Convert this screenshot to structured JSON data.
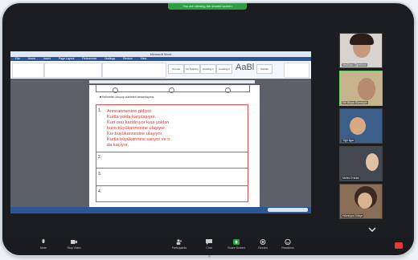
{
  "zoom_banner": "You are viewing the shared screen",
  "word": {
    "window_title": "Microsoft Word",
    "menu": [
      "File",
      "Home",
      "Insert",
      "Page Layout",
      "References",
      "Mailings",
      "Review",
      "View"
    ],
    "styles": [
      "Normal",
      "No Spacing",
      "Heading 1",
      "Heading 2",
      "Title",
      "Subtitle"
    ],
    "style_big": "AaBl",
    "bullet_text": "Kelimeleri okuyup cümleleri tamamlayınız.",
    "answers": [
      "Anneanmesine gidiyor.",
      "Kurtla yolda karşılaşıyor.",
      "Kurt onu kandırıyor kısa yoldan",
      "kızın büyükannesine ulaşıyor.",
      "Kız büyükannesine ulaşıyor.",
      "Kurtla büyükannesi sarıyor ve o",
      "da kaçıyor."
    ],
    "row_numbers": [
      "1.",
      "2.",
      "3.",
      "4."
    ]
  },
  "participants": [
    {
      "name": "Neslihan Öğretmen"
    },
    {
      "name": "Elif Büşra Ekerbiçer"
    },
    {
      "name": "Yiğit Ilgar"
    },
    {
      "name": "Melek Ertekin"
    },
    {
      "name": "Hümeyra Gökçe"
    }
  ],
  "toolbar": {
    "items": [
      "Mute",
      "Stop Video",
      "Participants",
      "Chat",
      "Share Screen",
      "Record",
      "Reactions"
    ],
    "participant_count": "5"
  },
  "colors": {
    "answer_red": "#e0322c",
    "share_green": "#2ea043",
    "end_red": "#e53935"
  }
}
